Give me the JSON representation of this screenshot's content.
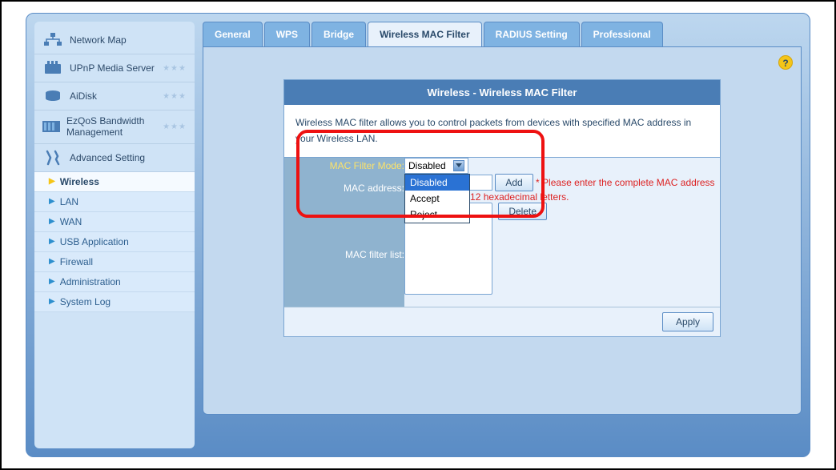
{
  "sidebar": {
    "items": [
      {
        "label": "Network Map",
        "icon": "network"
      },
      {
        "label": "UPnP Media Server",
        "icon": "media"
      },
      {
        "label": "AiDisk",
        "icon": "disk"
      },
      {
        "label": "EzQoS Bandwidth Management",
        "icon": "qos"
      },
      {
        "label": "Advanced Setting",
        "icon": "tools"
      }
    ],
    "subitems": [
      {
        "label": "Wireless",
        "active": true
      },
      {
        "label": "LAN"
      },
      {
        "label": "WAN"
      },
      {
        "label": "USB Application"
      },
      {
        "label": "Firewall"
      },
      {
        "label": "Administration"
      },
      {
        "label": "System Log"
      }
    ]
  },
  "tabs": [
    {
      "label": "General"
    },
    {
      "label": "WPS"
    },
    {
      "label": "Bridge"
    },
    {
      "label": "Wireless MAC Filter",
      "active": true
    },
    {
      "label": "RADIUS Setting"
    },
    {
      "label": "Professional"
    }
  ],
  "card": {
    "title": "Wireless - Wireless MAC Filter",
    "description": "Wireless MAC filter allows you to control packets from devices with specified MAC address in your Wireless LAN."
  },
  "form": {
    "mode_label": "MAC Filter Mode:",
    "mode_value": "Disabled",
    "mode_options": [
      "Disabled",
      "Accept",
      "Reject"
    ],
    "address_label": "MAC address:",
    "address_value": "",
    "address_hint": "* Please enter the complete MAC address which contains 12 hexadecimal letters.",
    "add_btn": "Add",
    "list_label": "MAC filter list:",
    "delete_btn": "Delete",
    "apply_btn": "Apply"
  },
  "help_tooltip": "?"
}
